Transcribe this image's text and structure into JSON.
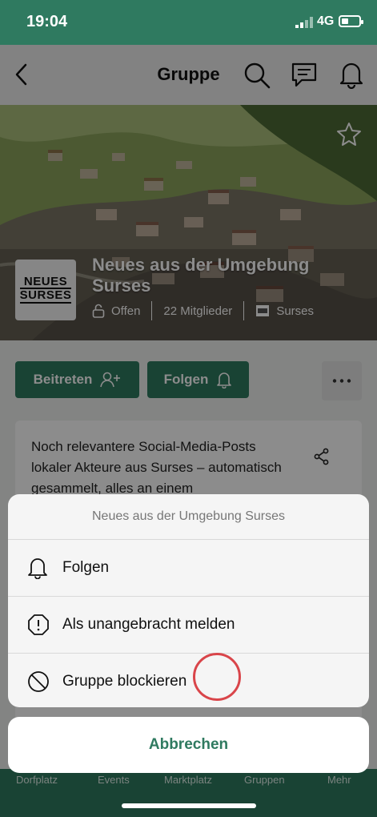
{
  "status": {
    "time": "19:04",
    "network": "4G"
  },
  "header": {
    "title": "Gruppe"
  },
  "group": {
    "logo_line1": "NEUES",
    "logo_line2": "SURSES",
    "title": "Neues aus der Umgebung Surses",
    "visibility": "Offen",
    "members": "22 Mitglieder",
    "location": "Surses"
  },
  "actions": {
    "join": "Beitreten",
    "follow": "Folgen"
  },
  "description": "Noch relevantere Social-Media-Posts lokaler Akteure aus Surses – automatisch gesammelt, alles an einem",
  "tabs": [
    "Dorfplatz",
    "Events",
    "Marktplatz",
    "Gruppen",
    "Mehr"
  ],
  "sheet": {
    "title": "Neues aus der Umgebung Surses",
    "items": [
      {
        "label": "Folgen",
        "icon": "bell-icon"
      },
      {
        "label": "Als unangebracht melden",
        "icon": "alert-octagon-icon"
      },
      {
        "label": "Gruppe blockieren",
        "icon": "block-icon"
      }
    ],
    "cancel": "Abbrechen"
  },
  "colors": {
    "brand": "#2f7a60",
    "tap_marker": "#d9454a"
  }
}
